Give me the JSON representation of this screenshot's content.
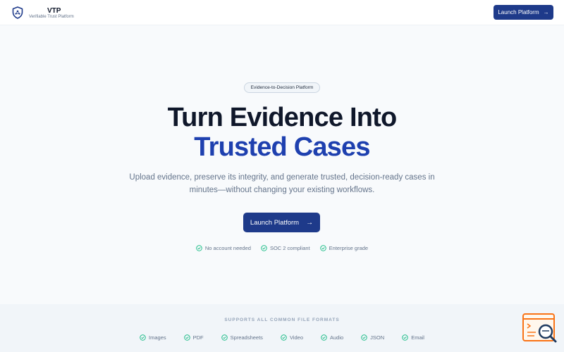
{
  "header": {
    "brand_title": "VTP",
    "brand_subtitle": "Verifiable Trust Platform",
    "launch_label": "Launch Platform",
    "logo_icon": "shield-icon"
  },
  "hero": {
    "badge": "Evidence-to-Decision Platform",
    "headline_line1": "Turn Evidence Into",
    "headline_line2": "Trusted Cases",
    "subtitle": "Upload evidence, preserve its integrity, and generate trusted, decision-ready cases in minutes—without changing your existing workflows.",
    "cta_label": "Launch Platform",
    "features": [
      {
        "label": "No account needed"
      },
      {
        "label": "SOC 2 compliant"
      },
      {
        "label": "Enterprise grade"
      }
    ]
  },
  "formats": {
    "title": "SUPPORTS ALL COMMON FILE FORMATS",
    "items": [
      "Images",
      "PDF",
      "Spreadsheets",
      "Video",
      "Audio",
      "JSON",
      "Email"
    ]
  },
  "colors": {
    "primary": "#1e3a8a",
    "accent_text": "#1e40af",
    "check": "#10b981",
    "widget_orange": "#f97316"
  }
}
